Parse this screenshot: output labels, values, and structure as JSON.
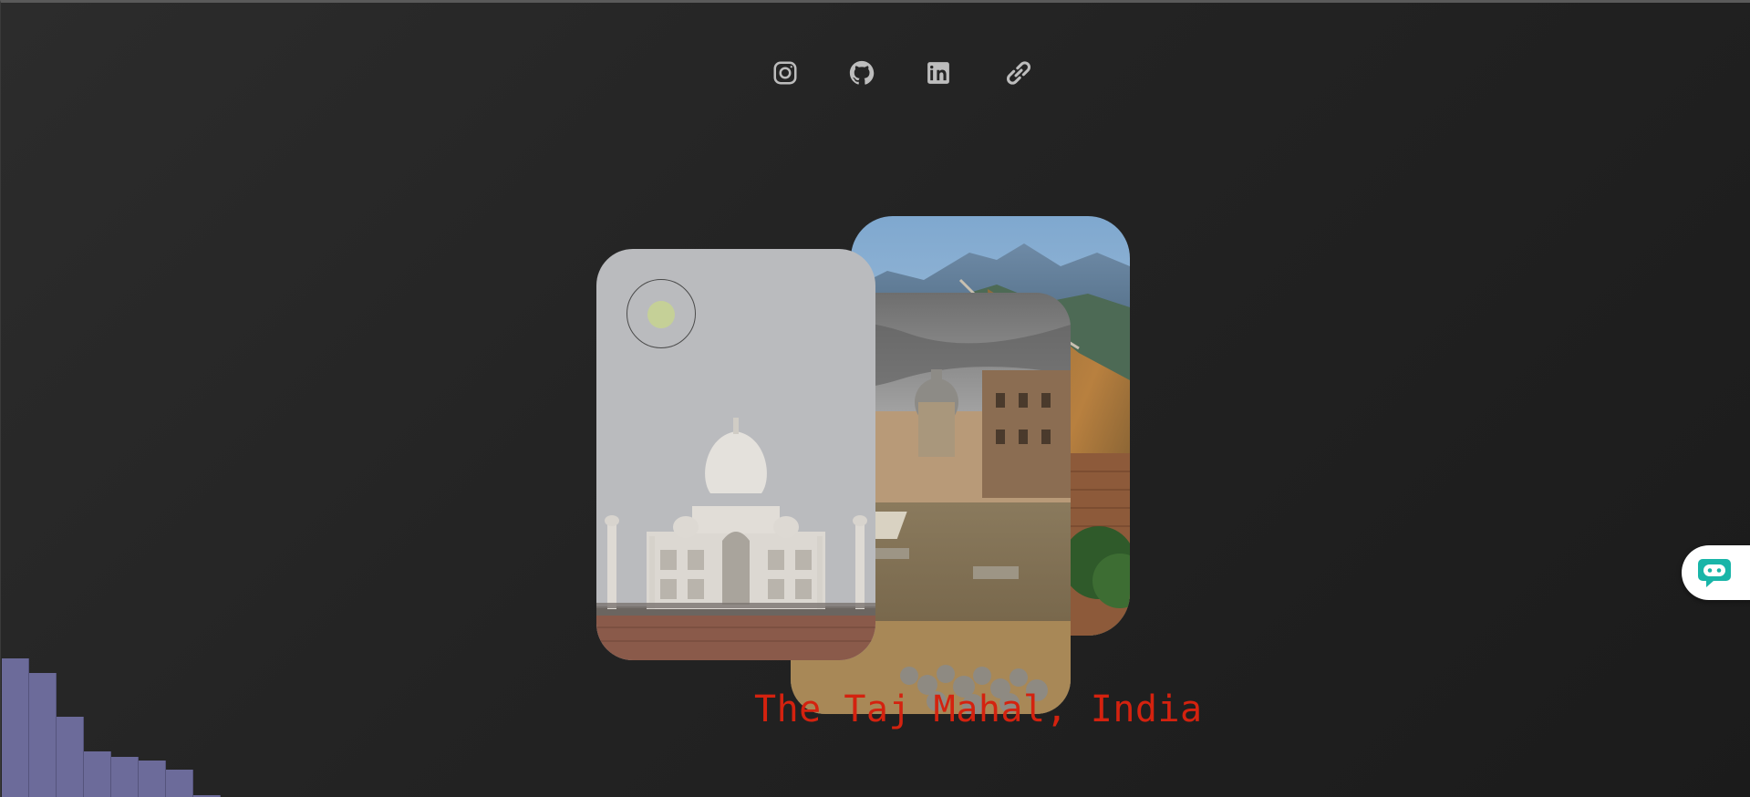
{
  "social": {
    "icons": [
      "instagram-icon",
      "github-icon",
      "linkedin-icon",
      "link-icon"
    ],
    "color": "#bdbdbd"
  },
  "gallery": {
    "active_caption": "The Taj Mahal, India",
    "caption_color": "#d4220f",
    "cards": [
      "taj-mahal",
      "roman-forum",
      "great-wall"
    ]
  },
  "decor": {
    "bar_color": "#6c6b9a",
    "bar_levels": [
      0.76,
      0.68,
      0.44,
      0.25,
      0.22,
      0.2,
      0.15,
      0.01
    ]
  },
  "chat": {
    "icon": "chat-bot-icon",
    "accent": "#18b5a8"
  }
}
